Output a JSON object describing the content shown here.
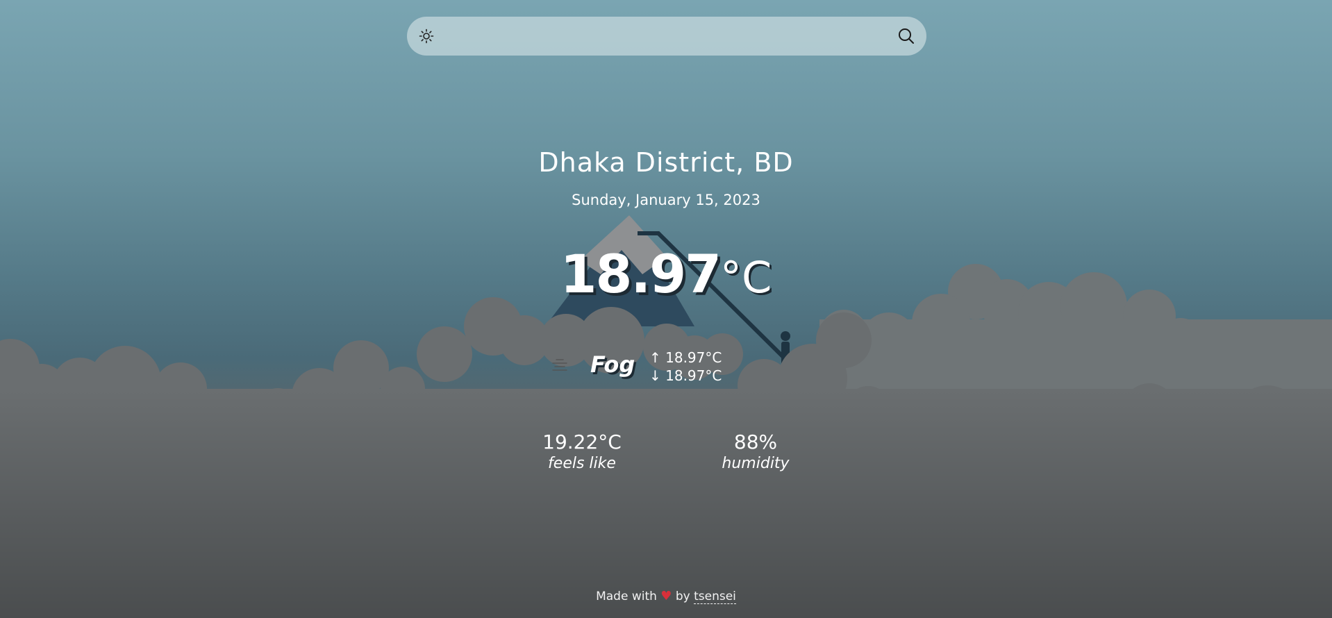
{
  "search": {
    "placeholder": "",
    "value": "",
    "theme_icon": "sun-icon",
    "search_icon": "search-icon"
  },
  "weather": {
    "location": "Dhaka District, BD",
    "date": "Sunday, January 15, 2023",
    "temperature": "18.97",
    "unit": "°C",
    "condition": "Fog",
    "condition_icon": "fog-icon",
    "high": "↑ 18.97°C",
    "low": "↓ 18.97°C"
  },
  "stats": {
    "feels_like_value": "19.22°C",
    "feels_like_label": "feels like",
    "humidity_value": "88%",
    "humidity_label": "humidity"
  },
  "footer": {
    "made_with": "Made with",
    "heart": "♥",
    "by": "by",
    "author": "tsensei"
  },
  "colors": {
    "sky_top": "#7aa5b2",
    "cloud": "#6b6f70",
    "mountain_dark": "#2e4a5e",
    "mountain_snow": "#8e9092",
    "heart": "#d9303a"
  }
}
